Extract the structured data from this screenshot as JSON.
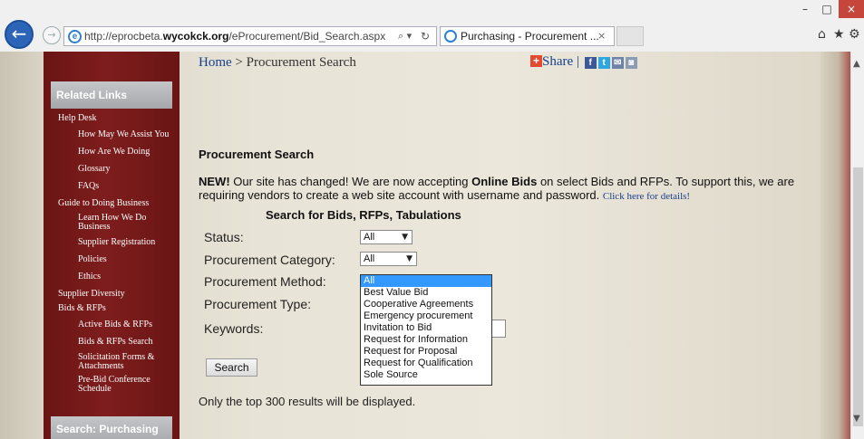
{
  "browser": {
    "window_controls": {
      "minimize": "–",
      "maximize": "□",
      "close": "×"
    },
    "back_glyph": "←",
    "forward_glyph": "→",
    "address": {
      "url_prefix": "http://eprocbeta.",
      "url_domain": "wycokck.org",
      "url_path": "/eProcurement/Bid_Search.aspx",
      "search_glyph": "⌕ ▾",
      "refresh_glyph": "↻"
    },
    "tab": {
      "title": "Purchasing - Procurement ...",
      "close_glyph": "×"
    },
    "toolbar": {
      "home": "⌂",
      "favorites": "★",
      "settings": "⚙"
    }
  },
  "scrollbar": {
    "up": "▲",
    "down": "▼"
  },
  "sidebar": {
    "header": "Related Links",
    "links": [
      "Help Desk",
      "How May We Assist You",
      "How Are We Doing",
      "Glossary",
      "FAQs",
      "Guide to Doing Business",
      "Learn How We Do",
      "Business",
      "Supplier Registration",
      "Policies",
      "Ethics",
      "Supplier Diversity",
      "Bids & RFPs",
      "Active Bids & RFPs",
      "Bids & RFPs Search",
      "Solicitation Forms &",
      "Attachments",
      "Pre-Bid Conference",
      "Schedule"
    ],
    "footer": "Search: Purchasing"
  },
  "breadcrumb": {
    "home": "Home",
    "separator": " > ",
    "current": "Procurement Search"
  },
  "share": {
    "plus": "+",
    "label": "Share",
    "separator": " | ",
    "icons": [
      "f",
      "t",
      "✉",
      "◙"
    ]
  },
  "main": {
    "title": "Procurement Search",
    "notice": {
      "new": "NEW!",
      "text1": " Our site has changed!  We are now accepting ",
      "bold": "Online Bids",
      "text2": " on select Bids and RFPs.  To support this, we are requiring vendors to create a web site account with username and password.  ",
      "details": "Click here for details!"
    },
    "subtitle": "Search for Bids, RFPs, Tabulations",
    "fields": {
      "status_label": "Status:",
      "status_value": "All",
      "category_label": "Procurement Category:",
      "category_value": "All",
      "method_label": "Procurement Method:",
      "type_label": "Procurement Type:",
      "keywords_label": "Keywords:"
    },
    "dropdown_arrow": "▼",
    "method_options": [
      "All",
      "Best Value Bid",
      "Cooperative Agreements",
      "Emergency procurement",
      "Invitation to Bid",
      "Request for Information",
      "Request for Proposal",
      "Request for Qualification",
      "Sole Source"
    ],
    "search_button": "Search",
    "note": "Only the top 300 results will be displayed."
  }
}
